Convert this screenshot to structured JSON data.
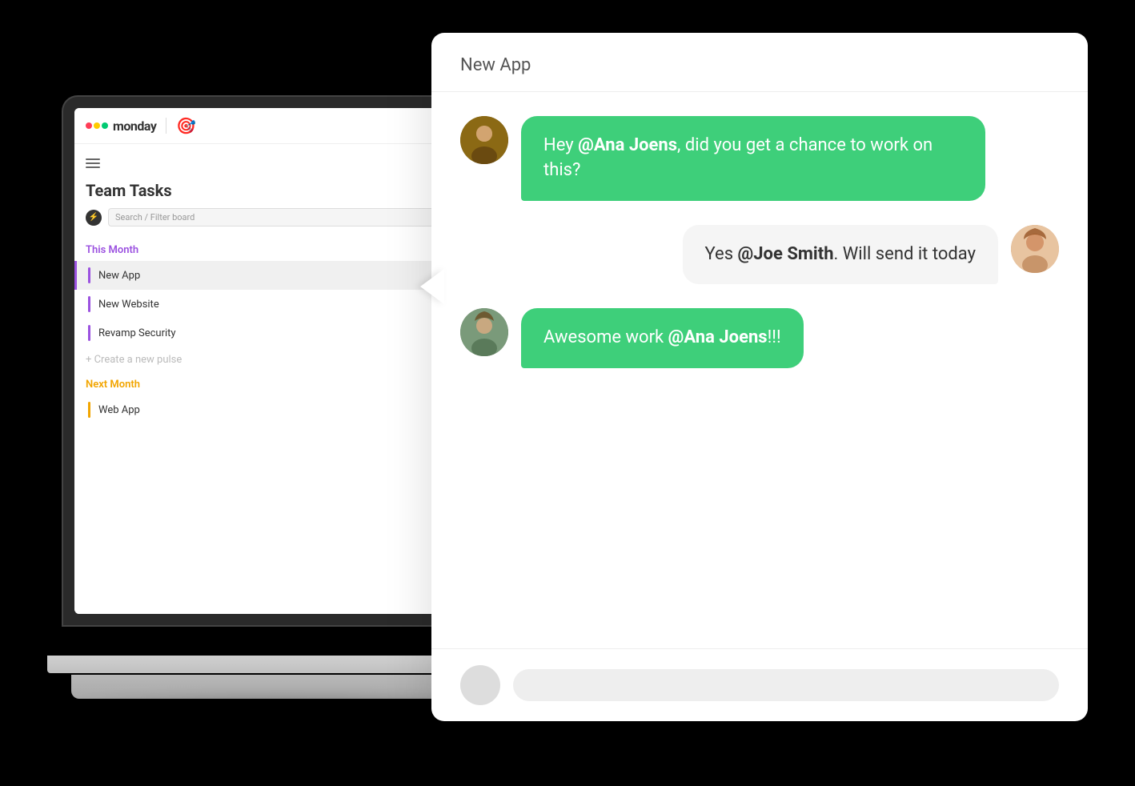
{
  "app": {
    "logo_text": "monday",
    "board_title": "Team Tasks",
    "search_placeholder": "Search / Filter board"
  },
  "sections": [
    {
      "label": "This Month",
      "type": "this-month",
      "items": [
        {
          "text": "New App",
          "active": true
        },
        {
          "text": "New Website",
          "active": false
        },
        {
          "text": "Revamp Security",
          "active": false
        }
      ],
      "create_label": "+ Create a new pulse"
    },
    {
      "label": "Next Month",
      "type": "next-month",
      "items": [
        {
          "text": "Web App",
          "active": false
        }
      ]
    }
  ],
  "chat": {
    "title": "New App",
    "messages": [
      {
        "type": "sent",
        "bubble_class": "green",
        "text_parts": [
          {
            "type": "text",
            "content": "Hey "
          },
          {
            "type": "mention",
            "content": "@Ana Joens"
          },
          {
            "type": "text",
            "content": ", did you get a chance to work on this?"
          }
        ]
      },
      {
        "type": "received",
        "bubble_class": "white",
        "text_parts": [
          {
            "type": "text",
            "content": "Yes "
          },
          {
            "type": "mention",
            "content": "@Joe Smith"
          },
          {
            "type": "text",
            "content": ". Will send it today"
          }
        ]
      },
      {
        "type": "sent",
        "bubble_class": "green",
        "text_parts": [
          {
            "type": "text",
            "content": "Awesome work "
          },
          {
            "type": "mention",
            "content": "@Ana Joens"
          },
          {
            "type": "text",
            "content": "!!!"
          }
        ]
      }
    ]
  }
}
